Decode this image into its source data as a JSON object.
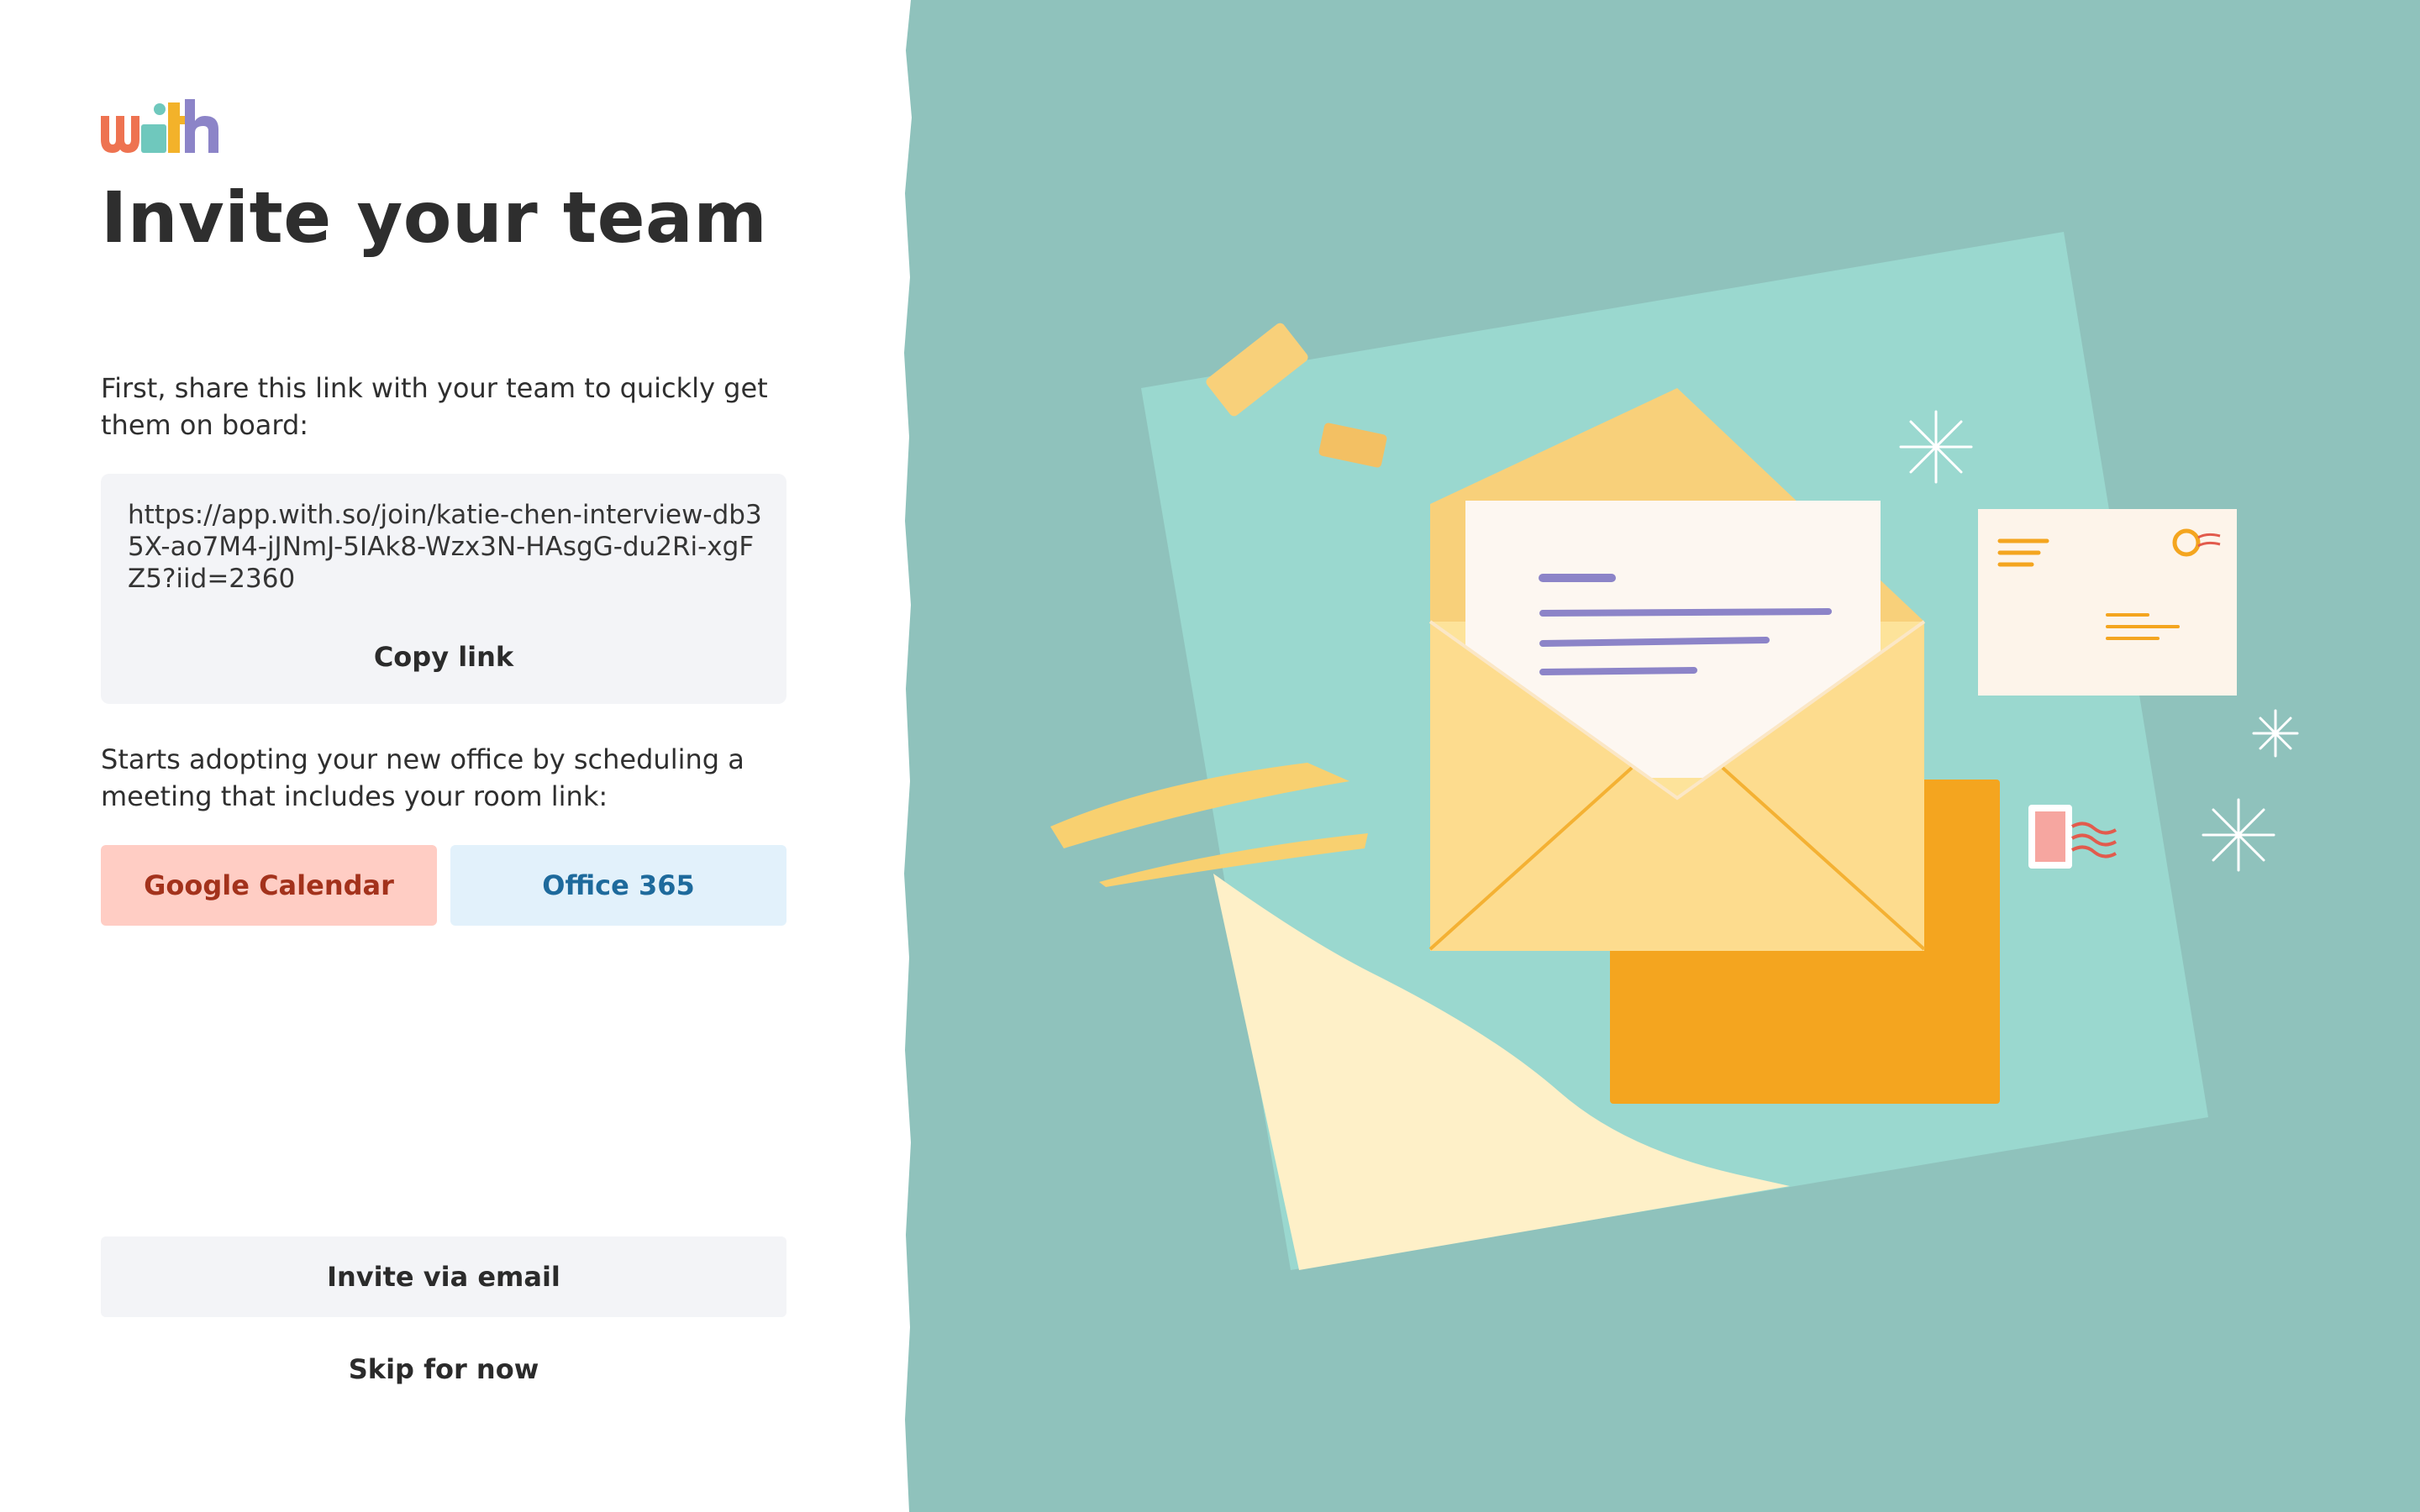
{
  "app": {
    "logo_text": "with",
    "colors": {
      "logo_w": "#ee7351",
      "logo_i": "#6fc8bd",
      "logo_t": "#f3b22a",
      "logo_h": "#8c84c8",
      "panel_bg": "#8fc2bc"
    }
  },
  "page": {
    "title": "Invite your team",
    "share_text": "First, share this link with your team to quickly get them on board:",
    "invite_link": "https://app.with.so/join/katie-chen-interview-db35X-ao7M4-jJNmJ-5IAk8-Wzx3N-HAsgG-du2Ri-xgFZ5?iid=2360",
    "copy_label": "Copy link",
    "schedule_text": "Starts adopting your new office by scheduling a meeting that includes your room link:",
    "google_calendar_label": "Google Calendar",
    "office365_label": "Office 365",
    "invite_email_label": "Invite via email",
    "skip_label": "Skip for now"
  },
  "illustration": {
    "icons": [
      "open-envelope-icon",
      "letter-icon",
      "postcard-icon",
      "closed-envelope-icon",
      "stamp-icon",
      "sparkle-icon"
    ]
  }
}
